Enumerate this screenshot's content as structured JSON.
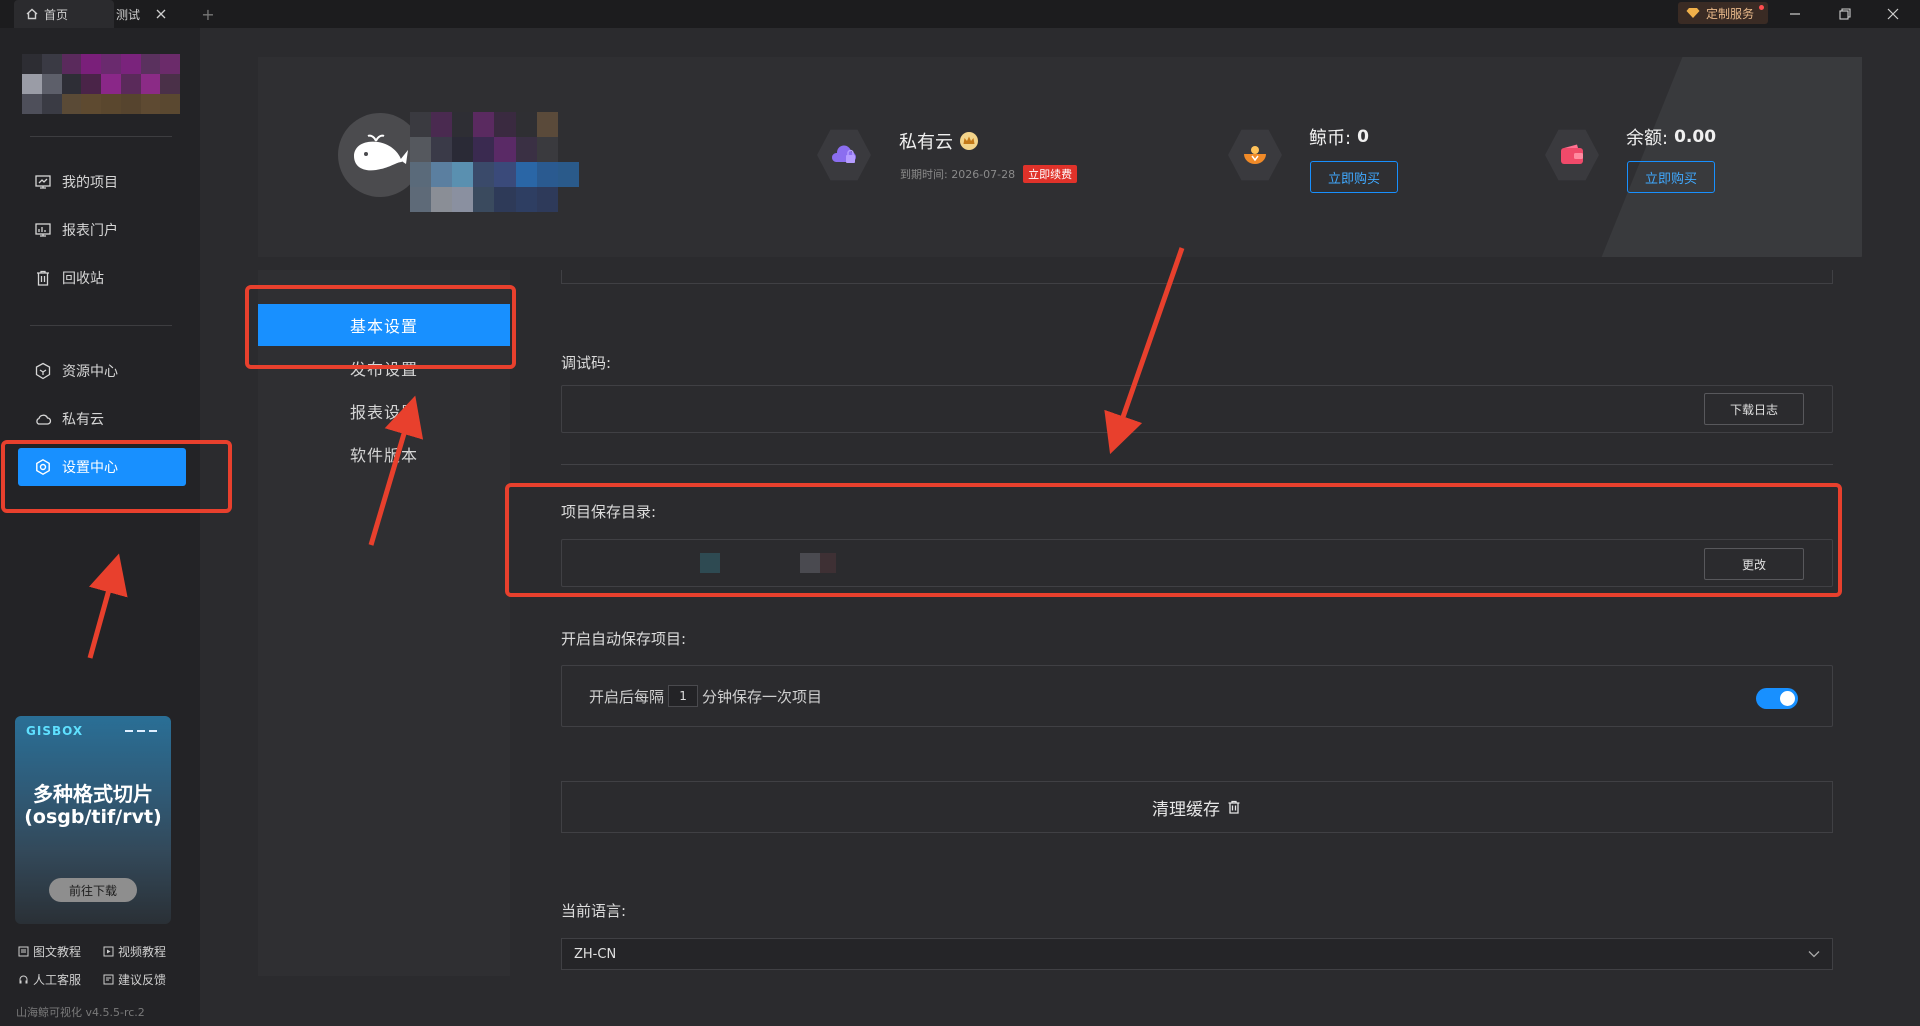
{
  "tabs": [
    {
      "label": "首页",
      "icon": "home-icon"
    },
    {
      "label": "测试",
      "icon": "close-icon"
    }
  ],
  "titlebar": {
    "custom_service": "定制服务"
  },
  "sidebar": {
    "items": [
      {
        "label": "我的项目",
        "icon": "project-icon"
      },
      {
        "label": "报表门户",
        "icon": "report-icon"
      },
      {
        "label": "回收站",
        "icon": "trash-icon"
      },
      {
        "label": "资源中心",
        "icon": "resource-icon"
      },
      {
        "label": "私有云",
        "icon": "cloud-icon"
      },
      {
        "label": "设置中心",
        "icon": "gear-icon",
        "active": true
      }
    ],
    "banner": {
      "brand": "GISBOX",
      "line1": "多种格式切片",
      "line2": "(osgb/tif/rvt)",
      "button": "前往下载"
    },
    "help": [
      "图文教程",
      "视频教程",
      "人工客服",
      "建议反馈"
    ],
    "version": "山海鲸可视化 v4.5.5-rc.2"
  },
  "header": {
    "private_cloud": {
      "title": "私有云",
      "expire_label": "到期时间: 2026-07-28",
      "renew": "立即续费"
    },
    "coins": {
      "title": "鲸币:",
      "value": "0",
      "button": "立即购买"
    },
    "balance": {
      "title": "余额:",
      "value": "0.00",
      "button": "立即购买"
    }
  },
  "menu": {
    "items": [
      "基本设置",
      "发布设置",
      "报表设置",
      "软件版本"
    ],
    "active_index": 0
  },
  "settings": {
    "debug_code": {
      "label": "调试码:",
      "button": "下载日志"
    },
    "save_dir": {
      "label": "项目保存目录:",
      "button": "更改"
    },
    "autosave": {
      "label": "开启自动保存项目:",
      "prefix": "开启后每隔",
      "interval": "1",
      "suffix": "分钟保存一次项目",
      "enabled": true
    },
    "clear_cache": "清理缓存",
    "language": {
      "label": "当前语言:",
      "value": "ZH-CN"
    }
  },
  "colors": {
    "accent": "#1890ff",
    "annotation": "#e8402d",
    "background": "#2b2b2e"
  }
}
